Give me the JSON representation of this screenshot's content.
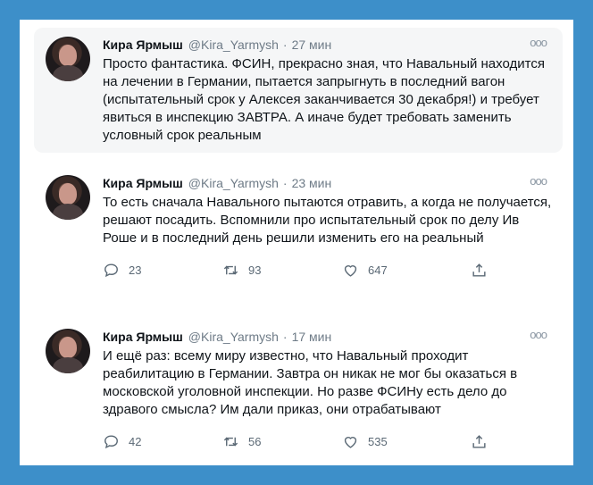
{
  "tweets": [
    {
      "name": "Кира Ярмыш",
      "handle": "@Kira_Yarmysh",
      "separator": "·",
      "time": "27 мин",
      "text": "Просто фантастика. ФСИН, прекрасно зная, что Навальный находится на лечении в Германии, пытается запрыгнуть в последний вагон (испытательный срок у Алексея заканчивается 30 декабря!) и требует явиться в инспекцию ЗАВТРА. А иначе будет требовать заменить условный срок реальным"
    },
    {
      "name": "Кира Ярмыш",
      "handle": "@Kira_Yarmysh",
      "separator": "·",
      "time": "23 мин",
      "text": "То есть сначала Навального пытаются отравить, а когда не получается, решают посадить. Вспомнили про испытательный срок по делу Ив Роше и в последний день решили изменить его на реальный",
      "replies": "23",
      "retweets": "93",
      "likes": "647"
    },
    {
      "name": "Кира Ярмыш",
      "handle": "@Kira_Yarmysh",
      "separator": "·",
      "time": "17 мин",
      "text": "И ещё раз: всему миру известно, что Навальный проходит реабилитацию в Германии. Завтра он никак не мог бы оказаться в московской уголовной инспекции. Но разве ФСИНу есть дело до здравого смысла? Им дали приказ, они отрабатывают",
      "replies": "42",
      "retweets": "56",
      "likes": "535"
    }
  ],
  "icons": {
    "more": "more-horizontal-icon",
    "reply": "reply-icon",
    "retweet": "retweet-icon",
    "like": "heart-icon",
    "share": "share-icon"
  },
  "colors": {
    "background": "#3d8fc9",
    "card": "#ffffff",
    "highlight": "#f5f6f7",
    "muted": "#6e7b87"
  }
}
